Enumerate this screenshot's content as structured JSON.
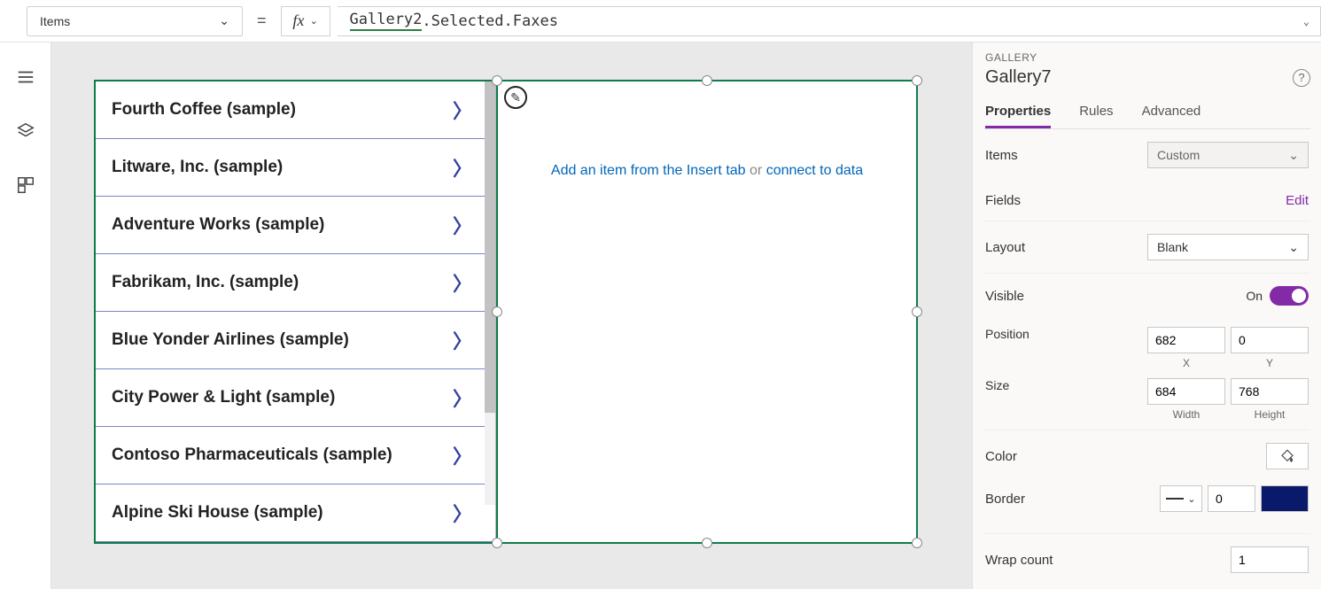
{
  "formulaBar": {
    "property": "Items",
    "equals": "=",
    "fx": "fx",
    "token": "Gallery2",
    "rest": ".Selected.Faxes"
  },
  "galleryItems": [
    "Fourth Coffee (sample)",
    "Litware, Inc. (sample)",
    "Adventure Works (sample)",
    "Fabrikam, Inc. (sample)",
    "Blue Yonder Airlines (sample)",
    "City Power & Light (sample)",
    "Contoso Pharmaceuticals (sample)",
    "Alpine Ski House (sample)"
  ],
  "emptyGallery": {
    "part1": "Add an item from the Insert tab",
    "part2": " or ",
    "part3": "connect to data"
  },
  "panel": {
    "headerSmall": "GALLERY",
    "name": "Gallery7",
    "tabs": {
      "properties": "Properties",
      "rules": "Rules",
      "advanced": "Advanced"
    },
    "items": {
      "label": "Items",
      "value": "Custom"
    },
    "fields": {
      "label": "Fields",
      "edit": "Edit"
    },
    "layout": {
      "label": "Layout",
      "value": "Blank"
    },
    "visible": {
      "label": "Visible",
      "state": "On"
    },
    "position": {
      "label": "Position",
      "x": "682",
      "y": "0",
      "xLabel": "X",
      "yLabel": "Y"
    },
    "size": {
      "label": "Size",
      "w": "684",
      "h": "768",
      "wLabel": "Width",
      "hLabel": "Height"
    },
    "color": {
      "label": "Color"
    },
    "border": {
      "label": "Border",
      "value": "0"
    },
    "wrap": {
      "label": "Wrap count",
      "value": "1"
    }
  }
}
